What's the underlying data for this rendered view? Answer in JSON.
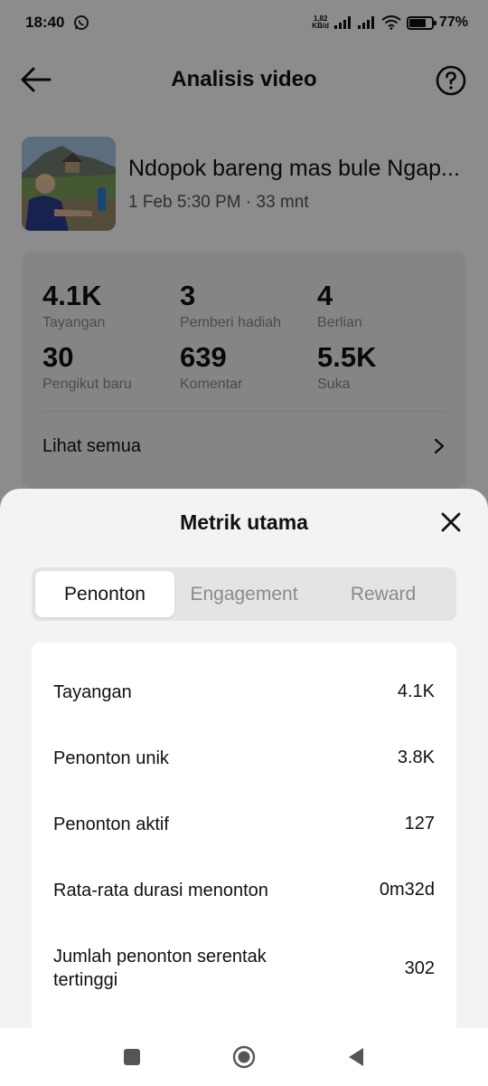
{
  "status_bar": {
    "time": "18:40",
    "net_speed_value": "1,82",
    "net_speed_unit": "KB/d",
    "battery": "77%",
    "battery_level": 0.77
  },
  "header": {
    "title": "Analisis video",
    "back_icon": "arrow-left-icon",
    "help_icon": "question-circle-icon"
  },
  "video": {
    "title": "Ndopok bareng mas bule Ngap...",
    "meta": "1 Feb 5:30 PM · 33 mnt"
  },
  "stats": [
    {
      "value": "4.1K",
      "label": "Tayangan"
    },
    {
      "value": "3",
      "label": "Pemberi hadiah"
    },
    {
      "value": "4",
      "label": "Berlian"
    },
    {
      "value": "30",
      "label": "Pengikut baru"
    },
    {
      "value": "639",
      "label": "Komentar"
    },
    {
      "value": "5.5K",
      "label": "Suka"
    }
  ],
  "see_all": "Lihat semua",
  "sheet": {
    "title": "Metrik utama",
    "tabs": [
      {
        "label": "Penonton",
        "active": true
      },
      {
        "label": "Engagement",
        "active": false
      },
      {
        "label": "Reward",
        "active": false
      }
    ],
    "metrics": [
      {
        "label": "Tayangan",
        "value": "4.1K"
      },
      {
        "label": "Penonton unik",
        "value": "3.8K"
      },
      {
        "label": "Penonton aktif",
        "value": "127"
      },
      {
        "label": "Rata-rata durasi menonton",
        "value": "0m32d"
      },
      {
        "label": "Jumlah penonton serentak tertinggi",
        "value": "302"
      }
    ]
  },
  "colors": {
    "overlay": "#000000",
    "sheet_bg": "#f3f3f3",
    "card_bg": "#ffffff",
    "tab_track": "#e4e4e4",
    "muted_text": "#8a8a8a"
  }
}
